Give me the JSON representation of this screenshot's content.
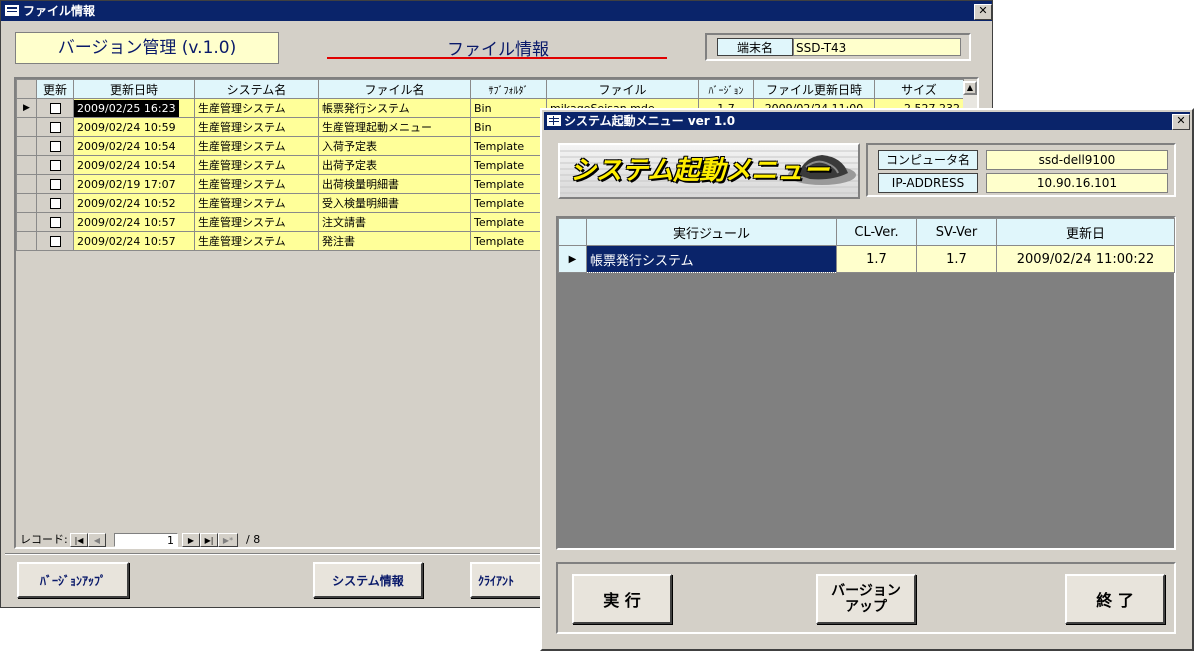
{
  "main": {
    "title": "ファイル情報",
    "version_label": "バージョン管理 (v.1.0)",
    "heading": "ファイル情報",
    "terminal_label": "端末名",
    "terminal_value": "SSD-T43",
    "columns": [
      "更新",
      "更新日時",
      "システム名",
      "ファイル名",
      "ｻﾌﾞﾌｫﾙﾀﾞ",
      "ファイル",
      "ﾊﾞｰｼﾞｮﾝ",
      "ファイル更新日時",
      "サイズ"
    ],
    "rows": [
      {
        "date": "2009/02/25 16:23",
        "system": "生産管理システム",
        "file": "帳票発行システム",
        "sub": "Bin",
        "fname": "mikageSeisan.mde",
        "ver": "1.7",
        "fdate": "2009/02/24 11:00",
        "size": "2,527,232"
      },
      {
        "date": "2009/02/24 10:59",
        "system": "生産管理システム",
        "file": "生産管理起動メニュー",
        "sub": "Bin"
      },
      {
        "date": "2009/02/24 10:54",
        "system": "生産管理システム",
        "file": "入荷予定表",
        "sub": "Template"
      },
      {
        "date": "2009/02/24 10:54",
        "system": "生産管理システム",
        "file": "出荷予定表",
        "sub": "Template"
      },
      {
        "date": "2009/02/19 17:07",
        "system": "生産管理システム",
        "file": "出荷検量明細書",
        "sub": "Template"
      },
      {
        "date": "2009/02/24 10:52",
        "system": "生産管理システム",
        "file": "受入検量明細書",
        "sub": "Template"
      },
      {
        "date": "2009/02/24 10:57",
        "system": "生産管理システム",
        "file": "注文請書",
        "sub": "Template"
      },
      {
        "date": "2009/02/24 10:57",
        "system": "生産管理システム",
        "file": "発注書",
        "sub": "Template"
      }
    ],
    "record_label": "レコード:",
    "record_current": "1",
    "record_total": "/ 8",
    "buttons": {
      "version_up": "ﾊﾞｰｼﾞｮﾝｱｯﾌﾟ",
      "system_info": "システム情報",
      "client": "ｸﾗｲｱﾝﾄ"
    }
  },
  "dialog": {
    "title": "システム起動メニュー  ver 1.0",
    "logo_text": "システム起動メニュー",
    "computer_label": "コンピュータ名",
    "computer_value": "ssd-dell9100",
    "ip_label": "IP-ADDRESS",
    "ip_value": "10.90.16.101",
    "columns": [
      "実行ジュール",
      "CL-Ver.",
      "SV-Ver",
      "更新日"
    ],
    "row": {
      "module": "帳票発行システム",
      "cl": "1.7",
      "sv": "1.7",
      "date": "2009/02/24 11:00:22"
    },
    "buttons": {
      "run": "実 行",
      "version_up_1": "バージョン",
      "version_up_2": "アップ",
      "exit": "終 了"
    }
  },
  "colors": {
    "titlebar": "#0a246a",
    "grid_yellow": "#ffff99",
    "header_cyan": "#e0f6fb",
    "heading_underline": "#e00000"
  }
}
